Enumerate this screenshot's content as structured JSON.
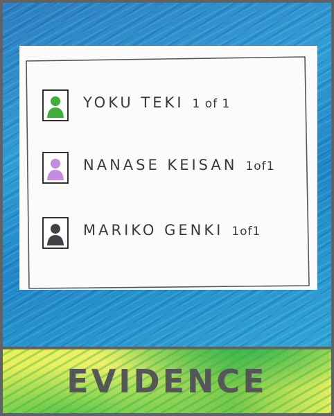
{
  "banner": {
    "title": "EVIDENCE"
  },
  "evidence_list": [
    {
      "name": "YOKU TEKI",
      "count": "1 of 1",
      "figure_color": "#3fae3a"
    },
    {
      "name": "NANASE KEISAN",
      "count": "1of1",
      "figure_color": "#c48be0"
    },
    {
      "name": "MARIKO GENKI",
      "count": "1of1",
      "figure_color": "#3f4347"
    }
  ]
}
